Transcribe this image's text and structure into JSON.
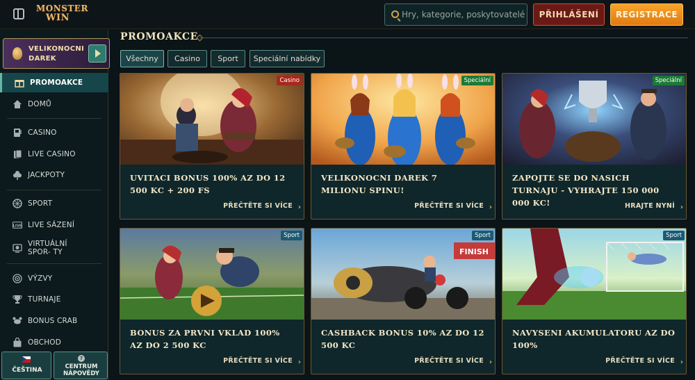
{
  "header": {
    "brand_line1": "MONSTER",
    "brand_line2": "WIN",
    "search_placeholder": "Hry, kategorie, poskytovatelé",
    "login_label": "PŘIHLÁŠENÍ",
    "register_label": "REGISTRACE"
  },
  "sidebar": {
    "promo_banner_label": "VELIKONOCNI DAREK",
    "items": [
      {
        "label": "PROMOAKCE",
        "icon": "gift-icon",
        "active": true
      },
      {
        "label": "DOMŮ",
        "icon": "home-icon"
      },
      {
        "label": "CASINO",
        "icon": "slot-machine-icon"
      },
      {
        "label": "LIVE CASINO",
        "icon": "cards-icon"
      },
      {
        "label": "JACKPOTY",
        "icon": "clover-icon"
      },
      {
        "label": "SPORT",
        "icon": "ball-icon"
      },
      {
        "label": "LIVE SÁZENÍ",
        "icon": "live-badge-icon"
      },
      {
        "label": "VIRTUÁLNÍ SPOR- TY",
        "icon": "virtual-sports-icon"
      },
      {
        "label": "VÝZVY",
        "icon": "target-icon"
      },
      {
        "label": "TURNAJE",
        "icon": "trophy-icon"
      },
      {
        "label": "BONUS CRAB",
        "icon": "crab-icon"
      },
      {
        "label": "OBCHOD",
        "icon": "bag-icon"
      }
    ],
    "language_label": "ČEŠTINA",
    "help_label": "CENTRUM NÁPOVĚDY"
  },
  "main": {
    "section_title": "PROMOAKCE",
    "filters": [
      "Všechny",
      "Casino",
      "Sport",
      "Speciální nabídky"
    ],
    "active_filter": "Všechny",
    "cards": [
      {
        "tag": "Casino",
        "tag_color": "#a8281b",
        "title": "UVITACI BONUS 100% AZ DO 12 500 KC + 200 FS",
        "link": "PŘEČTĚTE SI VÍCE"
      },
      {
        "tag": "Speciální",
        "tag_color": "#1b7a34",
        "title": "VELIKONOCNI DAREK 7 MILIONU SPINU!",
        "link": "PŘEČTĚTE SI VÍCE"
      },
      {
        "tag": "Speciální",
        "tag_color": "#1b7a34",
        "title": "ZAPOJTE SE DO NASICH TURNAJU - VYHRAJTE 150 000 000 KC!",
        "link": "HRAJTE NYNÍ"
      },
      {
        "tag": "Sport",
        "tag_color": "#1b5a72",
        "title": "BONUS ZA PRVNI VKLAD 100% AZ DO 2 500 KC",
        "link": "PŘEČTĚTE SI VÍCE"
      },
      {
        "tag": "Sport",
        "tag_color": "#1b5a72",
        "title": "CASHBACK BONUS 10% AZ DO 12 500 KC",
        "link": "PŘEČTĚTE SI VÍCE"
      },
      {
        "tag": "Sport",
        "tag_color": "#1b5a72",
        "title": "NAVYSENI AKUMULATORU AZ DO 100%",
        "link": "PŘEČTĚTE SI VÍCE"
      }
    ]
  },
  "colors": {
    "background": "#0b1417",
    "accent_orange": "#f39422",
    "login_red": "#6a1a14",
    "teal_active": "#17464a",
    "gold": "#d4a24a"
  }
}
